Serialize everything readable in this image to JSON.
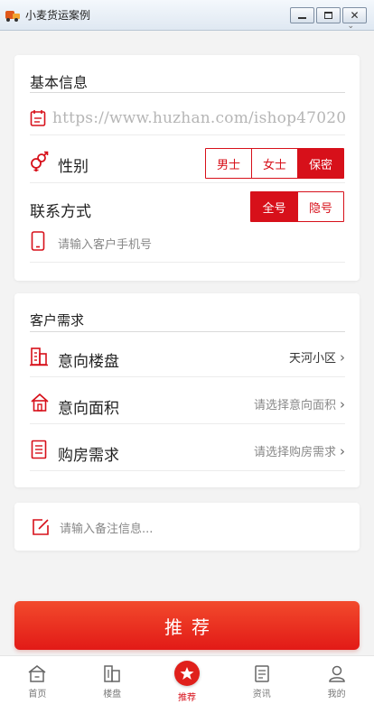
{
  "window": {
    "title": "小麦货运案例"
  },
  "watermark": "https://www.huzhan.com/ishop47020",
  "basic_info": {
    "title": "基本信息",
    "gender": {
      "label": "性别",
      "options": [
        "男士",
        "女士",
        "保密"
      ],
      "selected_index": 2
    },
    "contact": {
      "label": "联系方式",
      "options": [
        "全号",
        "隐号"
      ],
      "selected_index": 0,
      "phone_placeholder": "请输入客户手机号"
    }
  },
  "needs": {
    "title": "客户需求",
    "rows": [
      {
        "label": "意向楼盘",
        "value": "天河小区"
      },
      {
        "label": "意向面积",
        "value": "请选择意向面积"
      },
      {
        "label": "购房需求",
        "value": "请选择购房需求"
      }
    ]
  },
  "remark": {
    "placeholder": "请输入备注信息..."
  },
  "submit_label": "推荐",
  "tabbar": {
    "items": [
      {
        "label": "首页",
        "icon": "home-icon"
      },
      {
        "label": "楼盘",
        "icon": "building-icon"
      },
      {
        "label": "推荐",
        "icon": "star-icon"
      },
      {
        "label": "资讯",
        "icon": "news-icon"
      },
      {
        "label": "我的",
        "icon": "user-icon"
      }
    ],
    "active_index": 2
  },
  "colors": {
    "accent": "#d7101a",
    "button": "#e21a17"
  }
}
